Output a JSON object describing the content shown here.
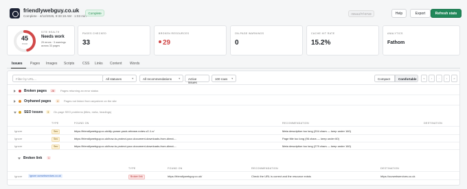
{
  "header": {
    "site": "friendlywebguy.co.uk",
    "meta": "Complete · 4/12/2026, 9:33:19 AM · 1:03 min",
    "status": "Complete",
    "session_chip": "rWvw1fYf-87o9",
    "help": "Help",
    "export": "Export",
    "refresh": "Refresh stats"
  },
  "health": {
    "score": "45",
    "score_value": 45,
    "score_label": "POOR",
    "label": "SITE HEALTH",
    "status": "Needs work",
    "detail": "29 errors · 3 warnings across 33 pages",
    "color": "#d14848"
  },
  "stats": [
    {
      "label": "PAGES CHECKED",
      "value": "33"
    },
    {
      "label": "BROKEN RESOURCES",
      "value": "29"
    },
    {
      "label": "ON-PAGE WARNINGS",
      "value": "0"
    },
    {
      "label": "CACHE HIT RATE",
      "value": "15.2%"
    },
    {
      "label": "ANALYTICS",
      "value": "Fathom"
    }
  ],
  "tabs": [
    "Issues",
    "Pages",
    "Images",
    "Scripts",
    "CSS",
    "Links",
    "Content",
    "Words"
  ],
  "filters": {
    "search_placeholder": "Filter by URL...",
    "statuses": "All statuses",
    "recommendations": "All recommendations",
    "active": "Active issues",
    "rows": "100 rows",
    "compact": "Compact",
    "comfortable": "Comfortable",
    "pager": [
      "«",
      "‹",
      "·",
      "›",
      "»"
    ]
  },
  "groups": {
    "broken_pages": {
      "name": "Broken pages",
      "count": "28",
      "desc": "Pages returning an error status"
    },
    "orphaned_pages": {
      "name": "Orphaned pages",
      "count": "4",
      "desc": "Pages not linked from anywhere on the site"
    },
    "seo_issues": {
      "name": "SEO issues",
      "count": "3",
      "desc": "On-page SEO problems (titles, meta, headings)"
    },
    "broken_link": {
      "name": "Broken link",
      "count": "1"
    }
  },
  "seo_table": {
    "headers": [
      "TYPE",
      "FOUND ON",
      "RECOMMENDATION",
      "DESTINATION"
    ],
    "rows": [
      {
        "action": "Ignore",
        "type": "Seo",
        "found": "https://friendlywebguy.co.uk/dlp-power-pack-release-notes-v2-1-x/",
        "rec": "Meta description too long (204 chars — keep under 160)"
      },
      {
        "action": "Ignore",
        "type": "Seo",
        "found": "https://friendlywebguy.co.uk/how-to-protect-your-document-downloads-from-direct-...",
        "rec": "Page title too long (96 chars — keep under 60)"
      },
      {
        "action": "Ignore",
        "type": "Seo",
        "found": "https://friendlywebguy.co.uk/how-to-protect-your-document-downloads-from-direct-...",
        "rec": "Meta description too long (279 chars — keep under 160)"
      }
    ]
  },
  "link_table": {
    "headers": [
      "TYPE",
      "FOUND ON",
      "RECOMMENDATION",
      "DESTINATION"
    ],
    "rows": [
      {
        "action": "Ignore",
        "chip": "Ignore ourwebservices.co.uk",
        "type": "Broken link",
        "found": "https://friendlywebguy.co.uk/",
        "rec": "Check the URL is correct and the resource exists",
        "dest": "https://ourwebservices.co.uk"
      }
    ]
  },
  "colors": {
    "accent": "#21885a",
    "broken": "#d14848",
    "orphan": "#e0892b",
    "seo": "#d9a520"
  }
}
